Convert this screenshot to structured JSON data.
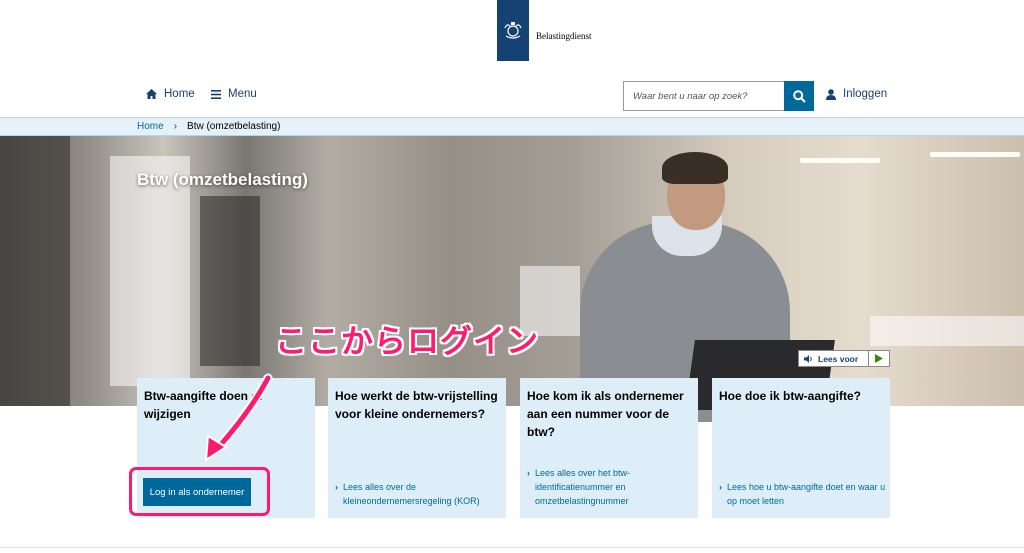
{
  "logo": {
    "text": "Belastingdienst"
  },
  "nav": {
    "home": "Home",
    "menu": "Menu",
    "search_placeholder": "Waar bent u naar op zoek?",
    "login": "Inloggen"
  },
  "breadcrumb": {
    "home": "Home",
    "current": "Btw (omzetbelasting)"
  },
  "hero": {
    "title": "Btw (omzetbelasting)",
    "annotation": "ここからログイン",
    "lees_voor": "Lees voor"
  },
  "cards": [
    {
      "title": "Btw-aangifte doen of wijzigen",
      "button": "Log in als ondernemer"
    },
    {
      "title": "Hoe werkt de btw-vrijstelling voor kleine ondernemers?",
      "link": "Lees alles over de kleineondernemersregeling (KOR)"
    },
    {
      "title": "Hoe kom ik als ondernemer aan een nummer voor de btw?",
      "link": "Lees alles over het btw-identificatienummer en omzetbelastingnummer"
    },
    {
      "title": "Hoe doe ik btw-aangifte?",
      "link": "Lees hoe u btw-aangifte doet en waar u op moet letten"
    }
  ],
  "colors": {
    "brand_blue": "#154273",
    "link_blue": "#01689b",
    "card_bg": "#ddeef8",
    "annotation_pink": "#ff1a6e"
  }
}
